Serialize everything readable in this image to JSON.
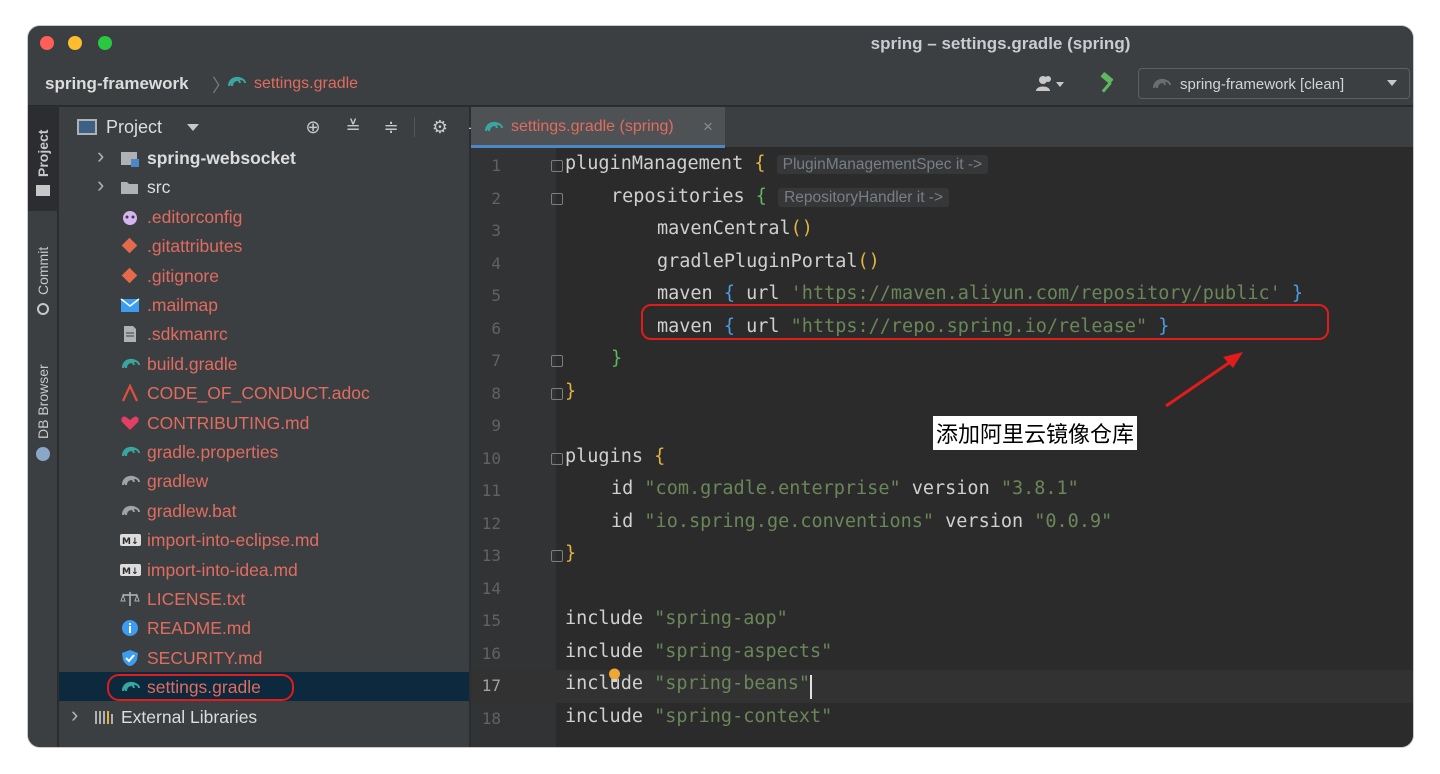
{
  "window": {
    "title": "spring – settings.gradle (spring)"
  },
  "navbar": {
    "project": "spring-framework",
    "file": "settings.gradle",
    "run_config": "spring-framework [clean]"
  },
  "toolstrip": {
    "tabs": [
      "Project",
      "Commit",
      "DB Browser"
    ]
  },
  "project_panel": {
    "title": "Project",
    "items": [
      {
        "label": "spring-websocket",
        "color": "#dcdcdc",
        "type": "module",
        "indent": 1,
        "expandable": true,
        "bold": true
      },
      {
        "label": "src",
        "color": "#dcdcdc",
        "type": "folder",
        "indent": 1,
        "expandable": true
      },
      {
        "label": ".editorconfig",
        "color": "#e06c60",
        "type": "editorconfig",
        "indent": 1
      },
      {
        "label": ".gitattributes",
        "color": "#e06c60",
        "type": "git",
        "indent": 1
      },
      {
        "label": ".gitignore",
        "color": "#e06c60",
        "type": "git",
        "indent": 1
      },
      {
        "label": ".mailmap",
        "color": "#e06c60",
        "type": "mail",
        "indent": 1
      },
      {
        "label": ".sdkmanrc",
        "color": "#e06c60",
        "type": "text",
        "indent": 1
      },
      {
        "label": "build.gradle",
        "color": "#e06c60",
        "type": "gradle",
        "indent": 1
      },
      {
        "label": "CODE_OF_CONDUCT.adoc",
        "color": "#e06c60",
        "type": "asciidoc",
        "indent": 1
      },
      {
        "label": "CONTRIBUTING.md",
        "color": "#e06c60",
        "type": "heart",
        "indent": 1
      },
      {
        "label": "gradle.properties",
        "color": "#e06c60",
        "type": "gradle",
        "indent": 1
      },
      {
        "label": "gradlew",
        "color": "#e06c60",
        "type": "gradle-gray",
        "indent": 1
      },
      {
        "label": "gradlew.bat",
        "color": "#e06c60",
        "type": "gradle-gray",
        "indent": 1
      },
      {
        "label": "import-into-eclipse.md",
        "color": "#e06c60",
        "type": "markdown",
        "indent": 1
      },
      {
        "label": "import-into-idea.md",
        "color": "#e06c60",
        "type": "markdown",
        "indent": 1
      },
      {
        "label": "LICENSE.txt",
        "color": "#e06c60",
        "type": "license",
        "indent": 1
      },
      {
        "label": "README.md",
        "color": "#e06c60",
        "type": "info",
        "indent": 1
      },
      {
        "label": "SECURITY.md",
        "color": "#e06c60",
        "type": "shield",
        "indent": 1
      },
      {
        "label": "settings.gradle",
        "color": "#e06c60",
        "type": "gradle",
        "indent": 1,
        "selected": true
      },
      {
        "label": "External Libraries",
        "color": "#dcdcdc",
        "type": "libraries",
        "indent": 0,
        "expandable": true
      }
    ]
  },
  "editor": {
    "tab_label": "settings.gradle (spring)",
    "current_line": 17,
    "annotation": "添加阿里云镜像仓库",
    "lines": [
      {
        "n": "1",
        "tokens": [
          [
            "fn",
            "pluginManagement "
          ],
          [
            "brace-y",
            "{"
          ],
          [
            "sp",
            " "
          ],
          [
            "hint",
            "PluginManagementSpec it ->"
          ]
        ],
        "indent": 0
      },
      {
        "n": "2",
        "tokens": [
          [
            "fn",
            "repositories "
          ],
          [
            "brace-g",
            "{"
          ],
          [
            "sp",
            " "
          ],
          [
            "hint",
            "RepositoryHandler it ->"
          ]
        ],
        "indent": 1
      },
      {
        "n": "3",
        "tokens": [
          [
            "fn",
            "mavenCentral"
          ],
          [
            "brace-y",
            "()"
          ]
        ],
        "indent": 2
      },
      {
        "n": "4",
        "tokens": [
          [
            "fn",
            "gradlePluginPortal"
          ],
          [
            "brace-y",
            "()"
          ]
        ],
        "indent": 2
      },
      {
        "n": "5",
        "tokens": [
          [
            "fn",
            "maven "
          ],
          [
            "brace-b",
            "{"
          ],
          [
            "fn",
            " url "
          ],
          [
            "str",
            "'https://maven.aliyun.com/repository/public'"
          ],
          [
            "fn",
            " "
          ],
          [
            "brace-b",
            "}"
          ]
        ],
        "indent": 2
      },
      {
        "n": "6",
        "tokens": [
          [
            "fn",
            "maven "
          ],
          [
            "brace-b",
            "{"
          ],
          [
            "fn",
            " url "
          ],
          [
            "str",
            "\"https://repo.spring.io/release\""
          ],
          [
            "fn",
            " "
          ],
          [
            "brace-b",
            "}"
          ]
        ],
        "indent": 2
      },
      {
        "n": "7",
        "tokens": [
          [
            "brace-g",
            "}"
          ]
        ],
        "indent": 1
      },
      {
        "n": "8",
        "tokens": [
          [
            "brace-y",
            "}"
          ]
        ],
        "indent": 0
      },
      {
        "n": "9",
        "tokens": [],
        "indent": 0
      },
      {
        "n": "10",
        "tokens": [
          [
            "fn",
            "plugins "
          ],
          [
            "brace-y",
            "{"
          ]
        ],
        "indent": 0
      },
      {
        "n": "11",
        "tokens": [
          [
            "fn",
            "id "
          ],
          [
            "str",
            "\"com.gradle.enterprise\""
          ],
          [
            "fn",
            " version "
          ],
          [
            "str",
            "\"3.8.1\""
          ]
        ],
        "indent": 1
      },
      {
        "n": "12",
        "tokens": [
          [
            "fn",
            "id "
          ],
          [
            "str",
            "\"io.spring.ge.conventions\""
          ],
          [
            "fn",
            " version "
          ],
          [
            "str",
            "\"0.0.9\""
          ]
        ],
        "indent": 1
      },
      {
        "n": "13",
        "tokens": [
          [
            "brace-y",
            "}"
          ]
        ],
        "indent": 0
      },
      {
        "n": "14",
        "tokens": [],
        "indent": 0
      },
      {
        "n": "15",
        "tokens": [
          [
            "fn",
            "include "
          ],
          [
            "str",
            "\"spring-aop\""
          ]
        ],
        "indent": 0
      },
      {
        "n": "16",
        "tokens": [
          [
            "fn",
            "include "
          ],
          [
            "str",
            "\"spring-aspects\""
          ]
        ],
        "indent": 0
      },
      {
        "n": "17",
        "tokens": [
          [
            "fn",
            "include "
          ],
          [
            "str",
            "\"spring-beans\""
          ]
        ],
        "indent": 0
      },
      {
        "n": "18",
        "tokens": [
          [
            "fn",
            "include "
          ],
          [
            "str",
            "\"spring-context\""
          ]
        ],
        "indent": 0
      }
    ]
  }
}
